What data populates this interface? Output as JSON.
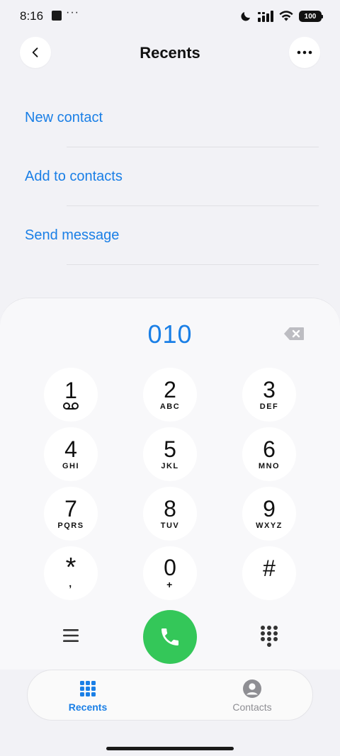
{
  "status_bar": {
    "time": "8:16",
    "more": "···",
    "battery": "100"
  },
  "header": {
    "title": "Recents",
    "back_icon": "chevron-left-icon",
    "more_icon": "more-horizontal-icon"
  },
  "options": [
    {
      "label": "New contact"
    },
    {
      "label": "Add to contacts"
    },
    {
      "label": "Send message"
    }
  ],
  "dialer": {
    "number": "010",
    "keys": [
      {
        "digit": "1",
        "letters": ""
      },
      {
        "digit": "2",
        "letters": "ABC"
      },
      {
        "digit": "3",
        "letters": "DEF"
      },
      {
        "digit": "4",
        "letters": "GHI"
      },
      {
        "digit": "5",
        "letters": "JKL"
      },
      {
        "digit": "6",
        "letters": "MNO"
      },
      {
        "digit": "7",
        "letters": "PQRS"
      },
      {
        "digit": "8",
        "letters": "TUV"
      },
      {
        "digit": "9",
        "letters": "WXYZ"
      },
      {
        "digit": "*",
        "letters": ","
      },
      {
        "digit": "0",
        "letters": "+"
      },
      {
        "digit": "#",
        "letters": ""
      }
    ],
    "call_color": "#34c759"
  },
  "tabs": [
    {
      "label": "Recents",
      "active": true
    },
    {
      "label": "Contacts",
      "active": false
    }
  ],
  "colors": {
    "accent": "#1a7fe6",
    "background": "#f2f2f6"
  }
}
